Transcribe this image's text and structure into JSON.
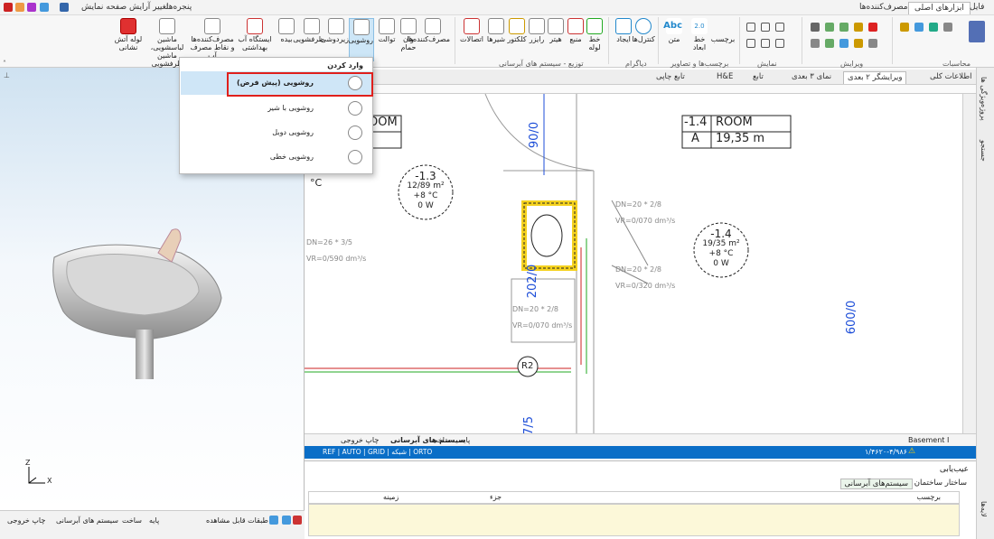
{
  "topbar": {
    "right_tabs": [
      "فایل",
      "ابزارهای اصلی",
      "مصرف‌کننده‌ها"
    ],
    "left_items": [
      "پنجره‌ها",
      "تغییر آرایش صفحه نمایش"
    ]
  },
  "ribbon": {
    "buttons": [
      "وان حمام",
      "توالت",
      "روشویی",
      "زیردوشی",
      "ظرفشویی",
      "بیده",
      "ایستگاه آب بهداشتی",
      "مصرف‌کننده‌ها و نقاط مصرف آب",
      "ماشین لباسشویی، ماشین ظرفشویی",
      "لوله آتش نشانی"
    ],
    "consumers_label": "مصرف‌کننده‌ها",
    "dist_buttons": [
      "خط لوله",
      "منبع",
      "هیتر",
      "رایزر",
      "کلکتور",
      "شیرها",
      "اتصالات"
    ],
    "diagram_buttons": [
      "ایجاد",
      "کنترل‌ها"
    ],
    "label_buttons": [
      "برچسب",
      "خط ابعاد",
      "متن"
    ],
    "groups": [
      "محاسبات",
      "ویرایش",
      "نمایش",
      "برچسب‌ها و تصاویر",
      "دیاگرام",
      "توزیع - سیستم های آبرسانی"
    ],
    "abc": "Abc",
    "dim_value": "2.0"
  },
  "dropdown": {
    "header": "وارد کردن",
    "items": [
      "روشویی (پیش فرض)",
      "روشویی با شیر",
      "روشویی دوبل",
      "روشویی خطی"
    ]
  },
  "doc_tabs": [
    "اطلاعات کلی",
    "ویرایشگر ۲ بعدی",
    "نمای ۳ بعدی",
    "تابع",
    "H&E",
    "تابع چاپی"
  ],
  "plan": {
    "room_left": "ROOM",
    "room_right": {
      "code": "-1.4",
      "name": "ROOM",
      "letter": "A",
      "area": "19,35 m"
    },
    "bubble1": [
      "-1.3",
      "12/89 m²",
      "+8 °C",
      "0 W"
    ],
    "bubble2": [
      "-1.4",
      "19/35 m²",
      "+8 °C",
      "0 W"
    ],
    "dim_90": "90/0",
    "dim_202": "202/0",
    "dim_600": "600/0",
    "dim_75": "7/5",
    "riser": "R2",
    "deg_c": "°C",
    "pipe_labels": [
      "DN=20 * 2/8",
      "DN=20 * 2/8",
      "DN=26 * 3/5",
      "DN=20 * 2/8"
    ],
    "flow_labels": [
      "VR=0/070 dm³/s",
      "VR=0/590 dm³/s",
      "VR=0/320 dm³/s",
      "VR=0/070 dm³/s"
    ]
  },
  "sysbar": {
    "items": [
      "پایه",
      "ساخت",
      "سیستم های آبرسانی",
      "چاپ خروجی"
    ],
    "level": "Basement I"
  },
  "statusbar": {
    "coords": "۱/۴۶۲۰-۴/۹۸۶",
    "modes": "REF | AUTO | GRID | شبکه | ORTO"
  },
  "lower": {
    "title": "عیب‌یابی",
    "tabs": [
      "ساختار ساختمان",
      "سیستم‌های آبرسانی"
    ],
    "columns": [
      "برچسب",
      "جزء",
      "زمینه"
    ]
  },
  "leftbar": {
    "items": [
      "پایه",
      "ساخت",
      "سیستم های آبرسانی",
      "چاپ خروجی"
    ],
    "layers": "طبقات قابل مشاهده"
  },
  "rightstrip": [
    "ویژگی ها",
    "پروژه",
    "جستجو",
    "لایه‌ها"
  ],
  "axis": {
    "x": "X",
    "z": "Z"
  },
  "colors": {
    "accent": "#0a6ec7",
    "highlight_red": "#e0201c",
    "select_yellow": "#f5d21f"
  }
}
